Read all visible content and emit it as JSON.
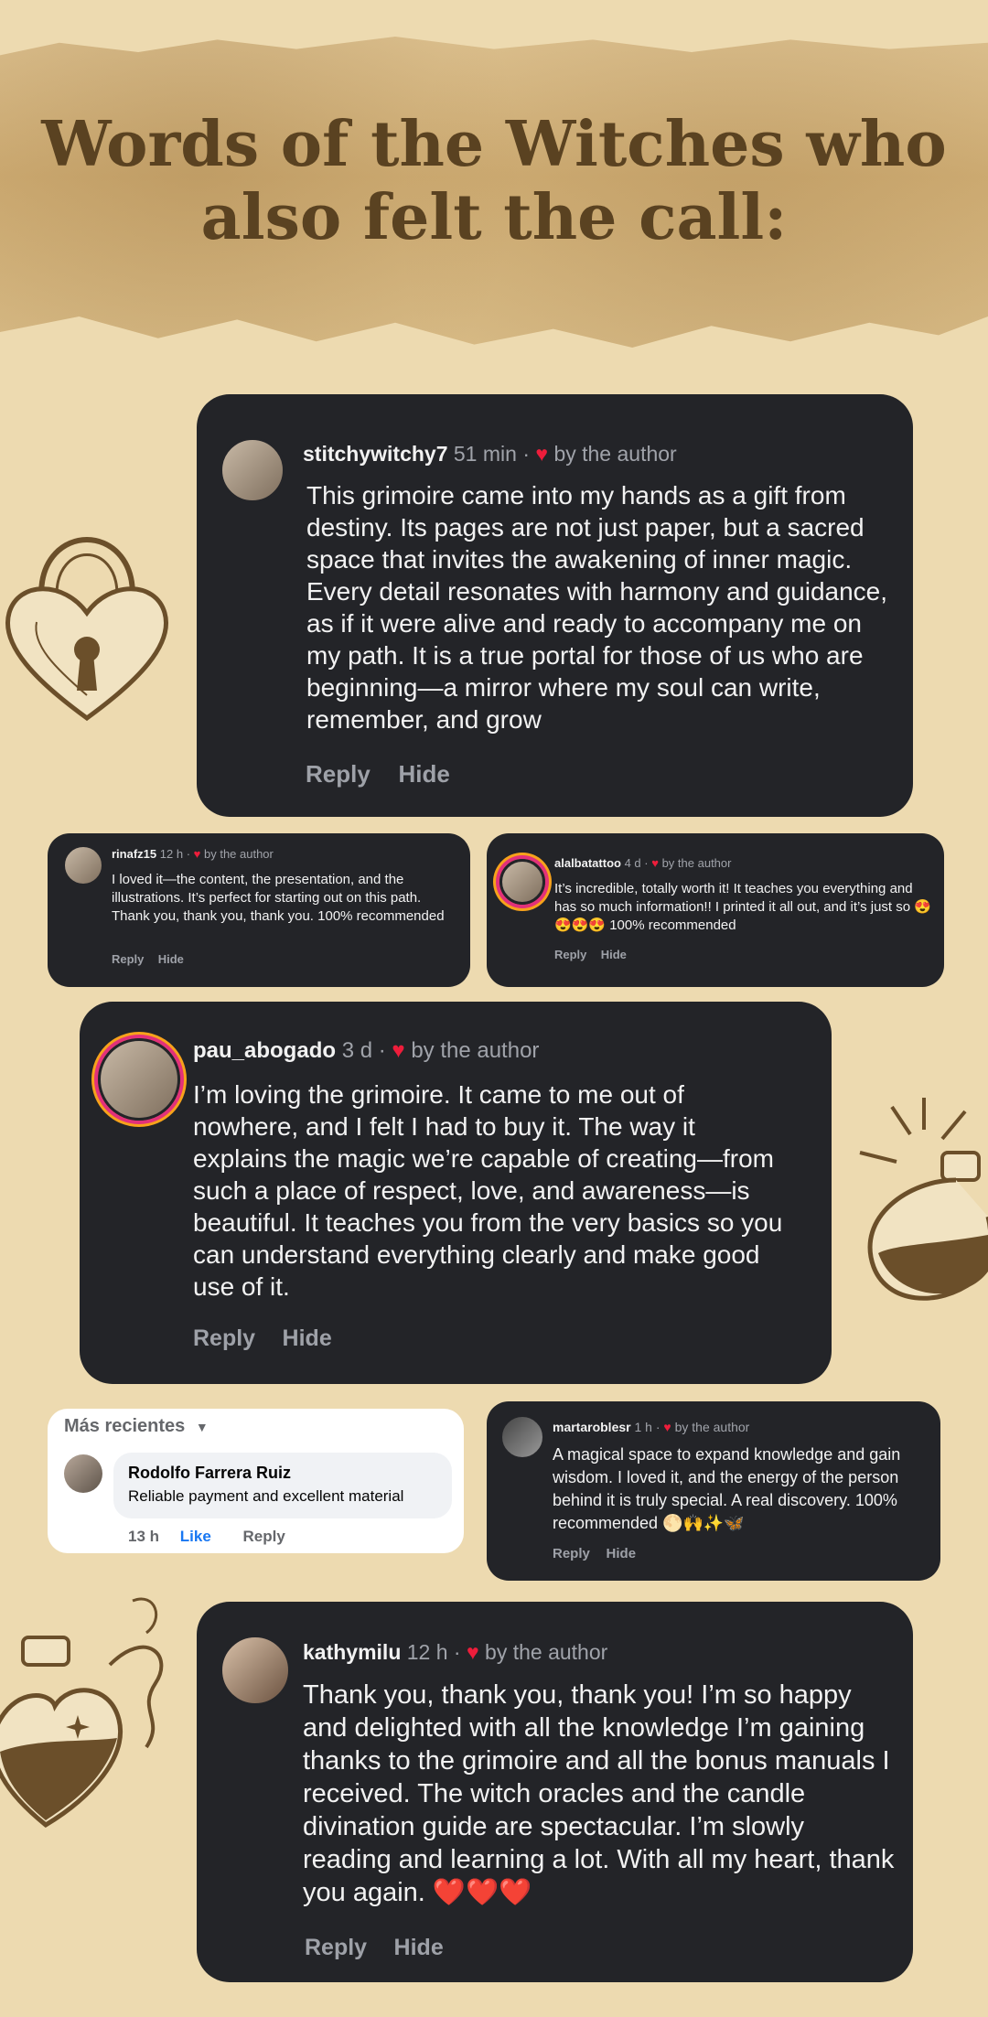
{
  "title": "Words of the Witches who also felt the call:",
  "comments": [
    {
      "user": "stitchywitchy7",
      "time": "51 min",
      "author_note": "by the author",
      "text": "This grimoire came into my hands as a gift from destiny. Its pages are not just paper, but a sacred space that invites the awakening of inner magic. Every detail resonates with harmony and guidance, as if it were alive and ready to accompany me on my path. It is a true portal for those of us who are beginning—a mirror where my soul can write, remember, and grow",
      "reply": "Reply",
      "hide": "Hide"
    },
    {
      "user": "rinafz15",
      "time": "12 h",
      "author_note": "by the author",
      "text": "I loved it—the content, the presentation, and the illustrations. It’s perfect for starting out on this path. Thank you, thank you, thank you. 100% recommended",
      "reply": "Reply",
      "hide": "Hide"
    },
    {
      "user": "alalbatattoo",
      "time": "4 d",
      "author_note": "by the author",
      "text": "It’s incredible, totally worth it! It teaches you everything and has so much information!! I printed it all out, and it’s just so 😍😍😍😍 100% recommended",
      "reply": "Reply",
      "hide": "Hide"
    },
    {
      "user": "pau_abogado",
      "time": "3 d",
      "author_note": "by the author",
      "text": "I’m loving the grimoire. It came to me out of nowhere, and I felt I had to buy it. The way it explains the magic we’re capable of creating—from such a place of respect, love, and awareness—is beautiful. It teaches you from the very basics so you can understand everything clearly and make good use of it.",
      "reply": "Reply",
      "hide": "Hide"
    },
    {
      "user": "martaroblesr",
      "time": "1 h",
      "author_note": "by the author",
      "text": "A magical space to expand knowledge and gain wisdom. I loved it, and the energy of the person behind it is truly special. A real discovery. 100% recommended 🌕🙌✨🦋",
      "reply": "Reply",
      "hide": "Hide"
    },
    {
      "user": "kathymilu",
      "time": "12 h",
      "author_note": "by the author",
      "text": "Thank you, thank you, thank you! I’m so happy and delighted with all the knowledge I’m gaining thanks to the grimoire and all the bonus manuals I received. The witch oracles and the candle divination guide are spectacular. I’m slowly reading and learning a lot. With all my heart, thank you again. ❤️❤️❤️",
      "reply": "Reply",
      "hide": "Hide"
    }
  ],
  "facebook": {
    "sort_label": "Más recientes",
    "name": "Rodolfo Farrera Ruiz",
    "text": "Reliable payment and excellent material",
    "time": "13 h",
    "like": "Like",
    "reply": "Reply"
  },
  "colors": {
    "background": "#eddab0",
    "card": "#232428",
    "title": "#5a4221",
    "heart": "#ee1d3b",
    "facebook_blue": "#1877f2"
  },
  "icons": [
    "heart-icon",
    "chevron-down-icon",
    "heart-padlock-illustration",
    "potion-bottle-illustration"
  ]
}
